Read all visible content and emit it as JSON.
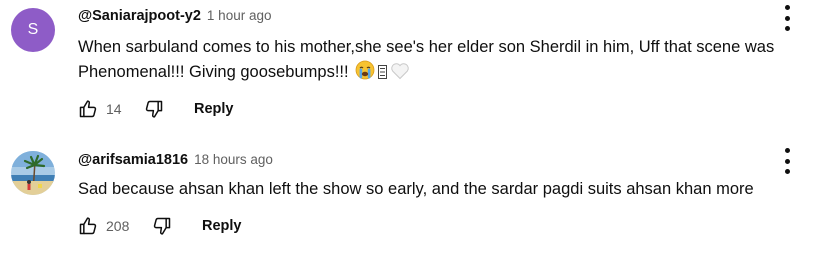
{
  "comments": [
    {
      "avatar_letter": "S",
      "avatar_color": "#8e5cc7",
      "handle": "@Saniarajpoot-y2",
      "time": "1 hour ago",
      "text": "When sarbuland comes to his mother,she see's her elder son Sherdil in him, Uff that scene was Phenomenal!!! Giving goosebumps!!! ",
      "emojis": [
        "loudly-crying-face-emoji",
        "broken-glyph",
        "white-heart-emoji"
      ],
      "likes": "14",
      "reply_label": "Reply"
    },
    {
      "avatar_type": "photo",
      "handle": "@arifsamia1816",
      "time": "18 hours ago",
      "text": "Sad because ahsan khan left the show so early, and the sardar pagdi suits ahsan khan more",
      "likes": "208",
      "reply_label": "Reply"
    }
  ],
  "colors": {
    "text_primary": "#0f0f0f",
    "text_secondary": "#606060",
    "background": "#ffffff"
  },
  "icons": [
    "thumbs-up-icon",
    "thumbs-down-icon",
    "more-vert-icon"
  ]
}
